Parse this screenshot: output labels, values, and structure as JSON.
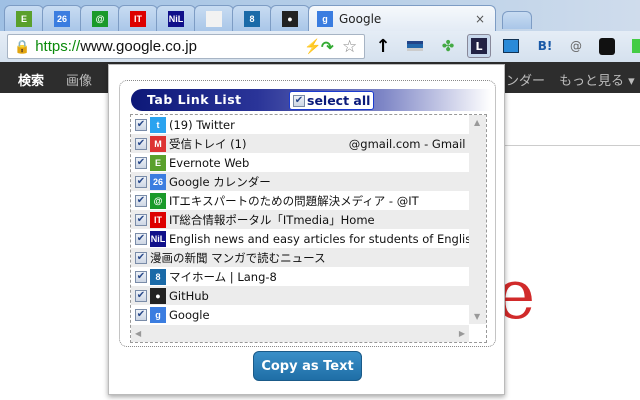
{
  "browser": {
    "tabs": [
      {
        "icon": "evernote-icon",
        "label": "",
        "color": "#5aa02c",
        "glyph": "E"
      },
      {
        "icon": "google-calendar-icon",
        "label": "",
        "color": "#3b7de0",
        "glyph": "26"
      },
      {
        "icon": "atmark-it-icon",
        "label": "",
        "color": "#1a9a2a",
        "glyph": "@"
      },
      {
        "icon": "itmedia-icon",
        "label": "",
        "color": "#d00",
        "glyph": "IT"
      },
      {
        "icon": "nil-icon",
        "label": "",
        "color": "#10108a",
        "glyph": "NiL"
      },
      {
        "icon": "document-icon",
        "label": "",
        "color": "#f2f2f2",
        "glyph": ""
      },
      {
        "icon": "lang8-icon",
        "label": "",
        "color": "#1a6aa8",
        "glyph": "8"
      },
      {
        "icon": "github-icon",
        "label": "",
        "color": "#222",
        "glyph": "●"
      }
    ],
    "active_tab": {
      "label": "Google",
      "glyph": "g",
      "color": "#3b7de0"
    },
    "close_glyph": "×",
    "url_scheme": "https://",
    "url_rest": "www.google.co.jp"
  },
  "gbar": {
    "items": [
      "検索",
      "画像"
    ],
    "right": [
      "ンダー",
      "もっと見る ▾"
    ]
  },
  "popup": {
    "title": "Tab Link List",
    "select_all": "select all",
    "copy_button": "Copy as Text",
    "rows": [
      {
        "title": "(19) Twitter",
        "icon": "twitter-icon",
        "glyph": "t",
        "color": "#2aa3ef",
        "checked": true
      },
      {
        "title": "受信トレイ (1)                            @gmail.com - Gmail",
        "icon": "gmail-icon",
        "glyph": "M",
        "color": "#d33",
        "checked": true
      },
      {
        "title": "Evernote Web",
        "icon": "evernote-icon",
        "glyph": "E",
        "color": "#5aa02c",
        "checked": true
      },
      {
        "title": "Google カレンダー",
        "icon": "google-calendar-icon",
        "glyph": "26",
        "color": "#3b7de0",
        "checked": true
      },
      {
        "title": "ITエキスパートのための問題解決メディア - @IT",
        "icon": "atmark-it-icon",
        "glyph": "@",
        "color": "#1a9a2a",
        "checked": true
      },
      {
        "title": "IT総合情報ポータル「ITmedia」Home",
        "icon": "itmedia-icon",
        "glyph": "IT",
        "color": "#d00",
        "checked": true
      },
      {
        "title": "English news and easy articles for students of English",
        "icon": "nil-icon",
        "glyph": "NiL",
        "color": "#10108a",
        "checked": true
      },
      {
        "title": "漫画の新聞 マンガで読むニュース",
        "icon": "",
        "glyph": "",
        "color": "",
        "checked": true
      },
      {
        "title": "マイホーム | Lang-8",
        "icon": "lang8-icon",
        "glyph": "8",
        "color": "#1a6aa8",
        "checked": true
      },
      {
        "title": "GitHub",
        "icon": "github-icon",
        "glyph": "●",
        "color": "#222",
        "checked": true
      },
      {
        "title": "Google",
        "icon": "google-icon",
        "glyph": "g",
        "color": "#3b7de0",
        "checked": true
      }
    ]
  },
  "page": {
    "logo_fragment": "e"
  }
}
